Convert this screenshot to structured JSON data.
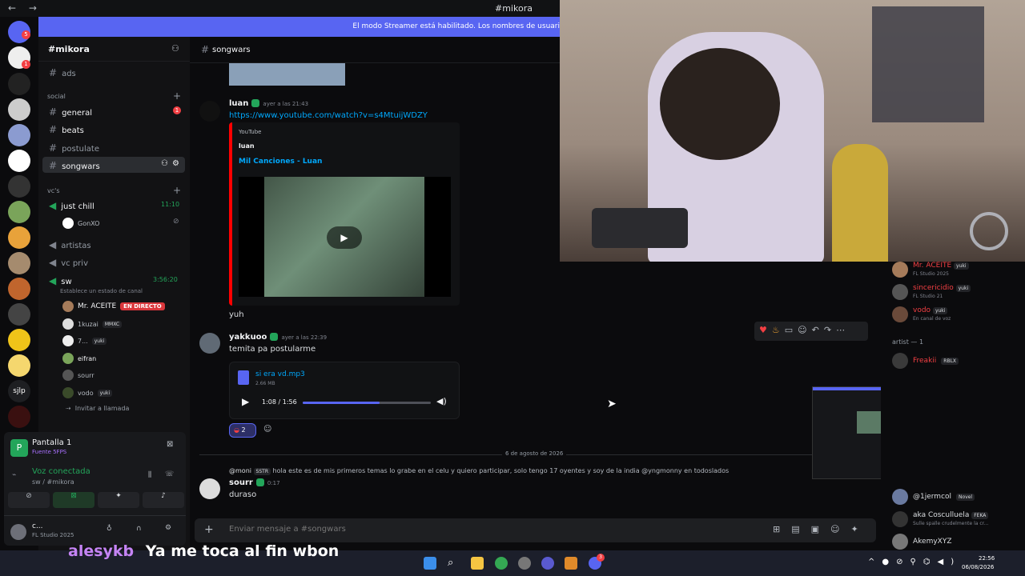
{
  "window": {
    "title": "#mikora",
    "nav_arrows": "← →"
  },
  "banner": {
    "text": "El modo Streamer está habilitado. Los nombres de usuari"
  },
  "rail": {
    "badges": [
      "5",
      "1"
    ],
    "server_labels": [
      "sjlp"
    ]
  },
  "sidebar": {
    "server_name": "#mikora",
    "channels_top": [
      {
        "label": "ads"
      }
    ],
    "category_social": "social",
    "social_channels": [
      {
        "label": "general",
        "badge": "1"
      },
      {
        "label": "beats"
      },
      {
        "label": "postulate"
      },
      {
        "label": "songwars"
      }
    ],
    "category_vc": "vc's",
    "voice_channels": [
      {
        "label": "just chill",
        "time": "11:10",
        "users": [
          "GonXO"
        ]
      },
      {
        "label": "artistas"
      },
      {
        "label": "vc priv"
      },
      {
        "label": "sw",
        "time": "3:56:20",
        "status": "Establece un estado de canal"
      }
    ],
    "sw_users": [
      {
        "name": "Mr. ACEITE",
        "live": "EN DIRECTO"
      },
      {
        "name": "1kuzai",
        "tag": "MMXC"
      },
      {
        "name": "7...",
        "tag": "yuki"
      },
      {
        "name": "eifran"
      },
      {
        "name": "sourr"
      },
      {
        "name": "vodo",
        "tag": "yuki"
      }
    ],
    "invite": "Invitar a llamada"
  },
  "panel": {
    "screen_title": "Pantalla 1",
    "screen_sub": "Fuente 5FPS",
    "voice_status": "Voz conectada",
    "voice_channel": "sw / #mikora",
    "user_name": "c...",
    "user_status": "FL Studio 2025"
  },
  "chat": {
    "channel": "songwars",
    "messages": {
      "luan": {
        "author": "luan",
        "time": "ayer a las 21:43",
        "link": "https://www.youtube.com/watch?v=s4MtuijWDZY",
        "embed_provider": "YouTube",
        "embed_author": "luan",
        "embed_title": "Mil Canciones - Luan"
      },
      "luan_followup": "yuh",
      "yakkuoo": {
        "author": "yakkuoo",
        "time": "ayer a las 22:39",
        "text": "temita pa postularme",
        "file_name": "si era vd.mp3",
        "file_size": "2.66 MB",
        "audio_time": "1:08 / 1:56",
        "audio_progress": 0.6,
        "reaction_count": "2"
      },
      "date_divider": "6 de agosto de 2026",
      "reply": {
        "reply_author": "@moni",
        "reply_tag": "SSTR",
        "reply_text": "hola este es de mis primeros temas lo grabe en el celu y quiero participar, solo tengo 17 oyentes y soy de la india @yngmonny en todoslados"
      },
      "sourr": {
        "author": "sourr",
        "time": "0:17",
        "text": "duraso"
      }
    },
    "composer_placeholder": "Enviar mensaje a #songwars"
  },
  "members": {
    "top": [
      {
        "name": "Mr. ACEITE",
        "tag": "yuki",
        "sub": "FL Studio 2025"
      },
      {
        "name": "sincericidio",
        "tag": "yuki",
        "sub": "FL Studio 21"
      },
      {
        "name": "vodo",
        "tag": "yuki",
        "sub": "En canal de voz"
      }
    ],
    "artist_header": "artist — 1",
    "artist": {
      "name": "Freakii",
      "tag": "RBLX"
    },
    "bottom": [
      {
        "name": "@1jermcol",
        "tag": "Novel"
      },
      {
        "name": "aka Cosculluela",
        "tag": "FEKA",
        "sub": "Sulle spalle crudelmente la cr..."
      },
      {
        "name": "AkemyXYZ"
      }
    ]
  },
  "caption": {
    "user": "alesykb",
    "text": "Ya me toca al fin wbon"
  },
  "taskbar": {
    "time": "22:56",
    "date": "06/08/2026",
    "discord_badge": "3"
  }
}
